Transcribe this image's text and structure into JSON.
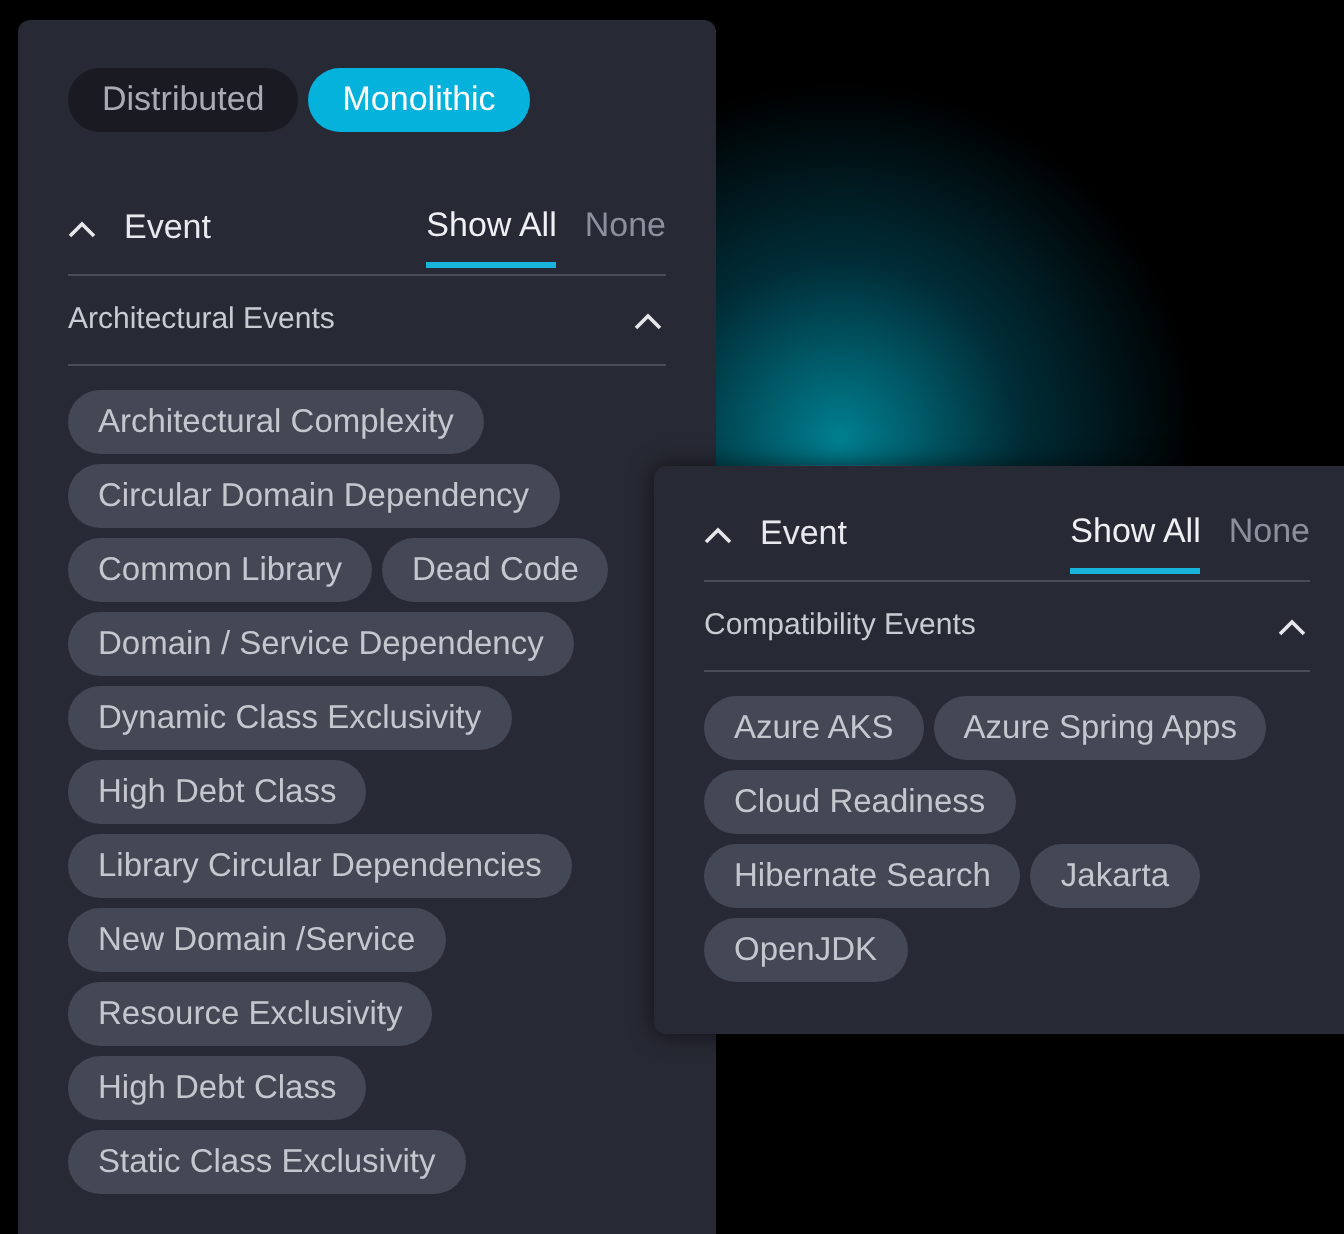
{
  "main_panel": {
    "tabs": [
      {
        "label": "Distributed",
        "selected": false
      },
      {
        "label": "Monolithic",
        "selected": true
      }
    ],
    "header": {
      "title": "Event",
      "expanded": true,
      "filters": [
        {
          "label": "Show All",
          "selected": true
        },
        {
          "label": "None",
          "selected": false
        }
      ]
    },
    "category": {
      "title": "Architectural Events",
      "expanded": true
    },
    "chips": [
      "Architectural Complexity",
      "Circular Domain Dependency",
      "Common Library",
      "Dead Code",
      "Domain / Service Dependency",
      "Dynamic Class Exclusivity",
      "High Debt Class",
      "Library Circular Dependencies",
      "New Domain /Service",
      "Resource Exclusivity",
      "High Debt Class",
      "Static Class Exclusivity"
    ]
  },
  "popup_panel": {
    "header": {
      "title": "Event",
      "expanded": true,
      "filters": [
        {
          "label": "Show All",
          "selected": true
        },
        {
          "label": "None",
          "selected": false
        }
      ]
    },
    "category": {
      "title": "Compatibility Events",
      "expanded": true
    },
    "chips": [
      "Azure AKS",
      "Azure Spring Apps",
      "Cloud Readiness",
      "Hibernate Search",
      "Jakarta",
      "OpenJDK"
    ]
  }
}
